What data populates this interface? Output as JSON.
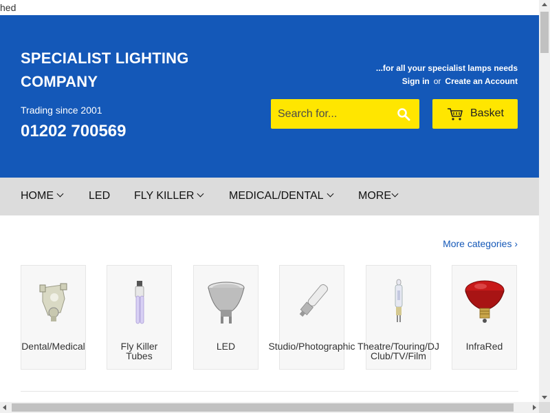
{
  "top_strip": {
    "text": "hed"
  },
  "header": {
    "brand_line1": "SPECIALIST LIGHTING",
    "brand_line2": "COMPANY",
    "trading_since": "Trading since 2001",
    "phone": "01202 700569",
    "tagline": "...for all your specialist lamps needs",
    "sign_in": "Sign in",
    "or": "or",
    "create_account": "Create an Account",
    "search_placeholder": "Search for...",
    "basket_label": "Basket",
    "colors": {
      "header_bg": "#1458b8",
      "accent": "#ffe600"
    }
  },
  "nav": {
    "items": [
      {
        "label": "HOME",
        "dropdown": true
      },
      {
        "label": "LED",
        "dropdown": false
      },
      {
        "label": "FLY KILLER",
        "dropdown": true
      },
      {
        "label": "MEDICAL/DENTAL",
        "dropdown": true
      },
      {
        "label": "MORE",
        "dropdown": true
      }
    ]
  },
  "categories": {
    "more_link": "More categories ›",
    "items": [
      {
        "line1": "Dental/Medical",
        "line2": "",
        "icon": "dental-lamp-icon"
      },
      {
        "line1": "Fly Killer",
        "line2": "Tubes",
        "icon": "fly-killer-tube-icon"
      },
      {
        "line1": "LED",
        "line2": "",
        "icon": "led-spotlight-icon"
      },
      {
        "line1": "Studio/Photographic",
        "line2": "",
        "icon": "studio-lamp-icon"
      },
      {
        "line1": "Theatre/Touring/DJ",
        "line2": "Club/TV/Film",
        "icon": "theatre-lamp-icon"
      },
      {
        "line1": "InfraRed",
        "line2": "",
        "icon": "infrared-bulb-icon"
      }
    ]
  }
}
